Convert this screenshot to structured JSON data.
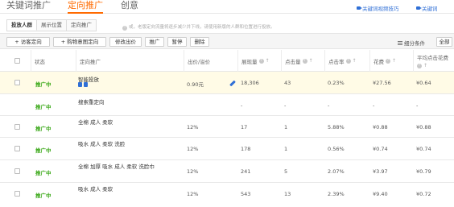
{
  "top_tabs": {
    "tab1": "关键词推广",
    "tab2": "定向推广",
    "tab3": "创意",
    "link1": "关键词视频技巧",
    "link2": "关键词"
  },
  "sub_tabs": [
    "投放人群",
    "展示位置",
    "定向推广"
  ],
  "tip": "或，老版定向流量将逐步减少并下线，请使用新版的人群和位置进行投放。",
  "toolbar": {
    "add_target": "+ 访客定向",
    "add_shopping": "+ 购物意图定向",
    "edit_bid": "修改出价",
    "promote": "推广",
    "pause": "暂停",
    "delete": "删除",
    "metrics": "细分条件",
    "all": "全部"
  },
  "columns": {
    "status": "状态",
    "target": "定向推广",
    "bid": "出价/溢价",
    "impressions": "展现量",
    "clicks": "点击量",
    "ctr": "点击率",
    "spend": "花费",
    "avg_cpc_line1": "平均点击花费"
  },
  "rows": [
    {
      "status": "推广中",
      "name": "智能投放",
      "bid": "0.90元",
      "impressions": "18,306",
      "clicks": "43",
      "ctr": "0.23%",
      "spend": "¥27.56",
      "cpc": "¥0.64"
    },
    {
      "status": "推广中",
      "name": "搜索重定向",
      "bid": "",
      "impressions": "-",
      "clicks": "-",
      "ctr": "-",
      "spend": "-",
      "cpc": "-"
    },
    {
      "status": "推广中",
      "name": "全棉 成人 柔软",
      "bid": "12%",
      "impressions": "17",
      "clicks": "1",
      "ctr": "5.88%",
      "spend": "¥0.88",
      "cpc": "¥0.88"
    },
    {
      "status": "推广中",
      "name": "吸水 成人 柔软 洗脸",
      "bid": "12%",
      "impressions": "178",
      "clicks": "1",
      "ctr": "0.56%",
      "spend": "¥0.74",
      "cpc": "¥0.74"
    },
    {
      "status": "推广中",
      "name": "全棉 加厚 吸水 成人 柔软 洗脸巾",
      "bid": "12%",
      "impressions": "241",
      "clicks": "5",
      "ctr": "2.07%",
      "spend": "¥3.97",
      "cpc": "¥0.79"
    },
    {
      "status": "推广中",
      "name": "吸水 成人 柔软",
      "bid": "12%",
      "impressions": "543",
      "clicks": "13",
      "ctr": "2.39%",
      "spend": "¥9.40",
      "cpc": "¥0.72"
    }
  ]
}
